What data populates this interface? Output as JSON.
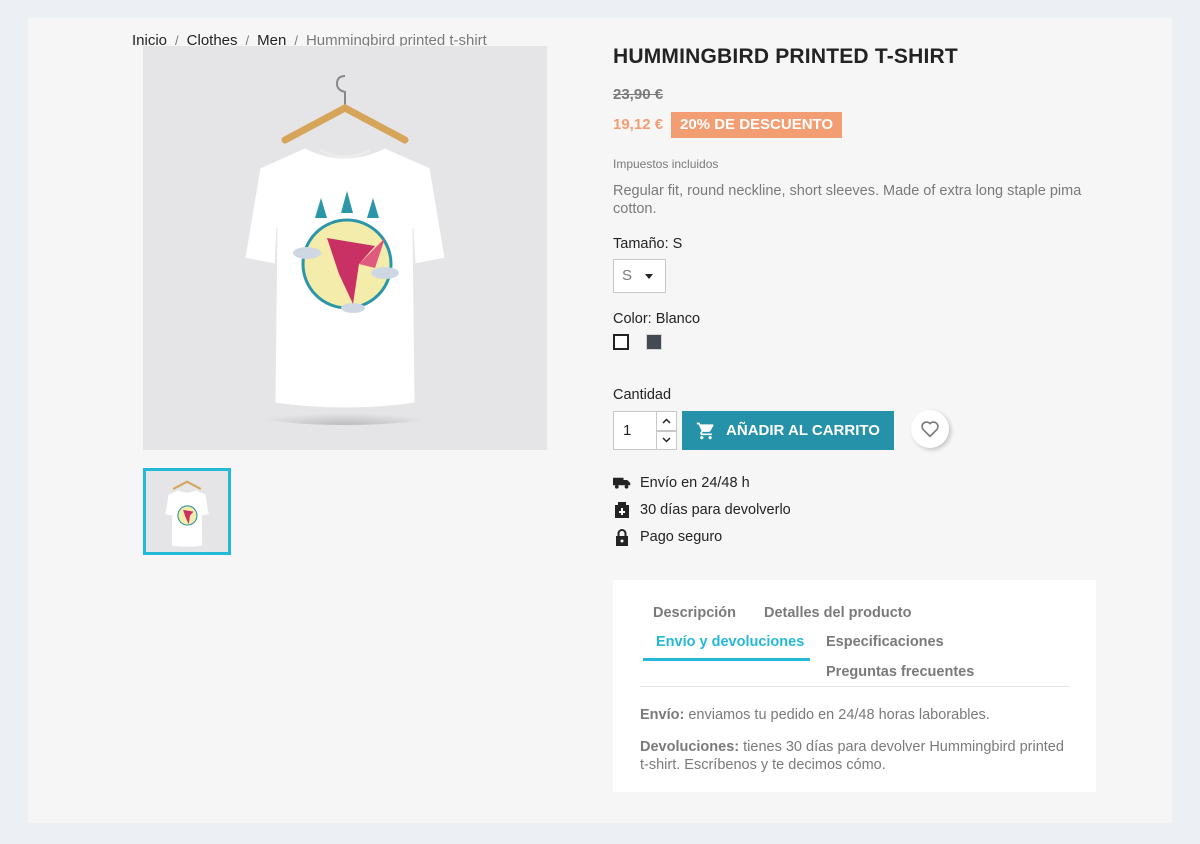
{
  "breadcrumb": {
    "home": "Inicio",
    "sep": "/",
    "category": "Clothes",
    "subcategory": "Men",
    "current": "Hummingbird printed t-shirt"
  },
  "product": {
    "title": "HUMMINGBIRD PRINTED T-SHIRT",
    "old_price": "23,90 €",
    "price": "19,12 €",
    "discount": "20% DE DESCUENTO",
    "tax_label": "Impuestos incluidos",
    "description": "Regular fit, round neckline, short sleeves. Made of extra long staple pima cotton.",
    "size_label": "Tamaño: S",
    "size_value": "S",
    "color_label": "Color: Blanco",
    "colors": [
      "#ffffff",
      "#434a54"
    ],
    "qty_label": "Cantidad",
    "qty_value": "1",
    "add_to_cart": "AÑADIR AL CARRITO"
  },
  "reassurance": [
    {
      "icon": "truck-icon",
      "text": "Envío en 24/48 h"
    },
    {
      "icon": "return-box-icon",
      "text": "30 días para devolverlo"
    },
    {
      "icon": "lock-icon",
      "text": "Pago seguro"
    }
  ],
  "tabs": {
    "items": [
      "Descripción",
      "Detalles del producto",
      "Envío y devoluciones",
      "Especificaciones",
      "Preguntas frecuentes"
    ],
    "active": "Envío y devoluciones",
    "shipping_label": "Envío:",
    "shipping_text": "enviamos tu pedido en 24/48 horas laborables.",
    "returns_label": "Devoluciones:",
    "returns_text": "tienes 30 días para devolver Hummingbird printed t-shirt. Escríbenos y te decimos cómo."
  },
  "colors": {
    "accent": "#24b9d7",
    "button": "#2592a9",
    "discount": "#f39d72"
  }
}
